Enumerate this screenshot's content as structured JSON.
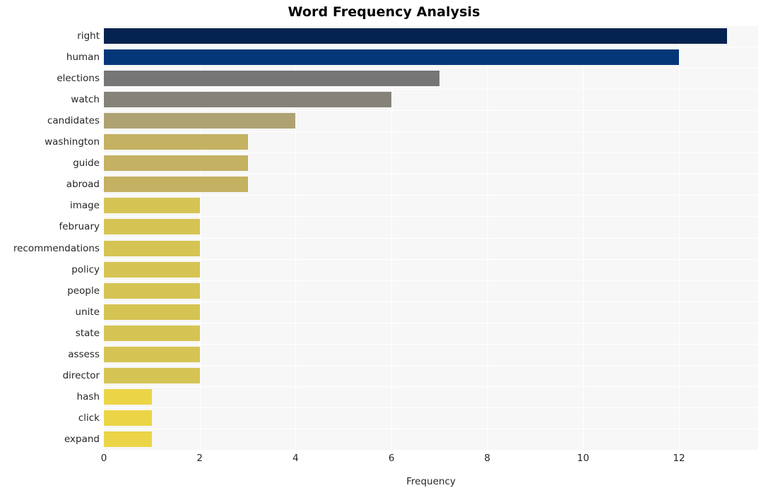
{
  "chart_data": {
    "type": "bar",
    "orientation": "horizontal",
    "title": "Word Frequency Analysis",
    "xlabel": "Frequency",
    "ylabel": "",
    "categories": [
      "right",
      "human",
      "elections",
      "watch",
      "candidates",
      "washington",
      "guide",
      "abroad",
      "image",
      "february",
      "recommendations",
      "policy",
      "people",
      "unite",
      "state",
      "assess",
      "director",
      "hash",
      "click",
      "expand"
    ],
    "values": [
      13,
      12,
      7,
      6,
      4,
      3,
      3,
      3,
      2,
      2,
      2,
      2,
      2,
      2,
      2,
      2,
      2,
      1,
      1,
      1
    ],
    "bar_colors": [
      "#04244f",
      "#043778",
      "#767676",
      "#858279",
      "#aea273",
      "#c4b161",
      "#c4b161",
      "#c4b161",
      "#d5c454",
      "#d5c454",
      "#d5c454",
      "#d5c454",
      "#d5c454",
      "#d5c454",
      "#d5c454",
      "#d5c454",
      "#d5c454",
      "#ecd447",
      "#ecd447",
      "#ecd447"
    ],
    "xticks": [
      0,
      2,
      4,
      6,
      8,
      10,
      12
    ],
    "xtick_labels": [
      "0",
      "2",
      "4",
      "6",
      "8",
      "10",
      "12"
    ],
    "xlim": [
      0,
      13.65
    ],
    "grid": true,
    "grid_color": "#ffffff",
    "plot_background": "#f7f7f7",
    "figure_background": "#ffffff",
    "text_color": "#262626",
    "title_color": "#000000"
  }
}
